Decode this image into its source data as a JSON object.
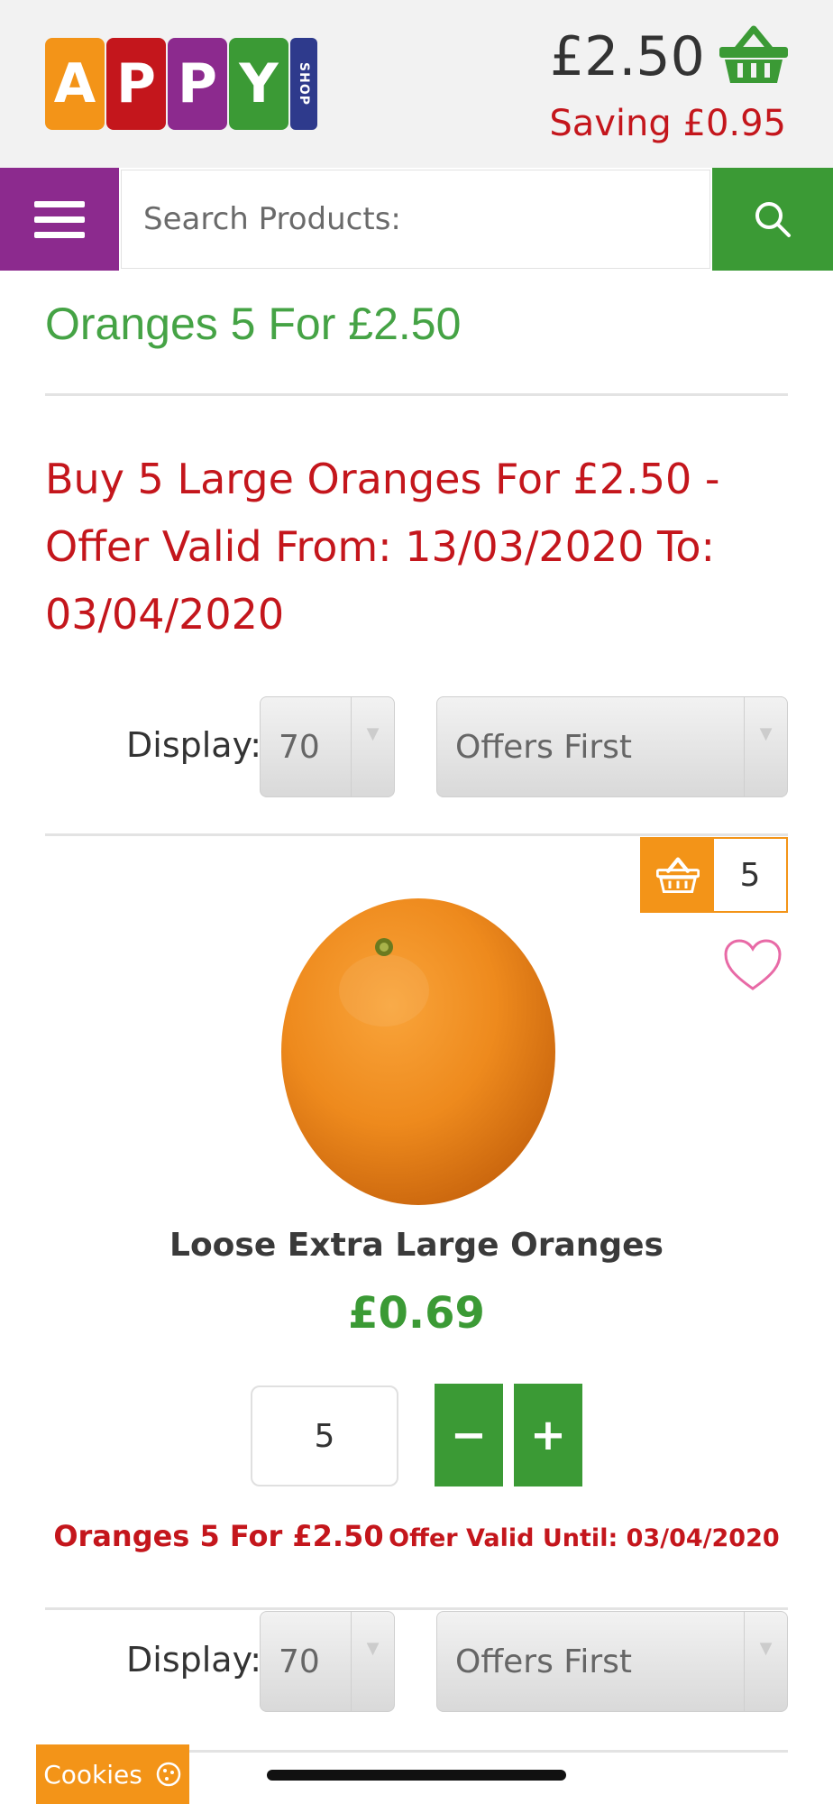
{
  "header": {
    "logo_letters": [
      "A",
      "P",
      "P",
      "Y"
    ],
    "logo_sub": "SHOP",
    "cart_total": "£2.50",
    "saving": "Saving £0.95",
    "icons": {
      "cart": "basket-icon",
      "menu": "hamburger-menu-icon",
      "search": "search-icon"
    }
  },
  "search": {
    "placeholder": "Search Products:"
  },
  "page": {
    "title": "Oranges 5 For £2.50",
    "offer_description": "Buy 5 Large Oranges For £2.50 - Offer Valid From: 13/03/2020 To: 03/04/2020"
  },
  "display_controls": {
    "label": "Display:",
    "per_page": "70",
    "sort": "Offers First"
  },
  "product": {
    "name": "Loose Extra Large Oranges",
    "price": "£0.69",
    "basket_count": "5",
    "quantity": "5",
    "minus_label": "−",
    "plus_label": "+",
    "offer_name": "Oranges 5 For £2.50",
    "offer_valid": "Offer Valid Until: 03/04/2020"
  },
  "footer": {
    "cookies_label": "Cookies"
  },
  "colors": {
    "brand_green": "#3b9a35",
    "brand_purple": "#8c2a8e",
    "brand_red": "#c4161c",
    "brand_orange": "#f39418",
    "brand_blue": "#2e3a8c"
  }
}
